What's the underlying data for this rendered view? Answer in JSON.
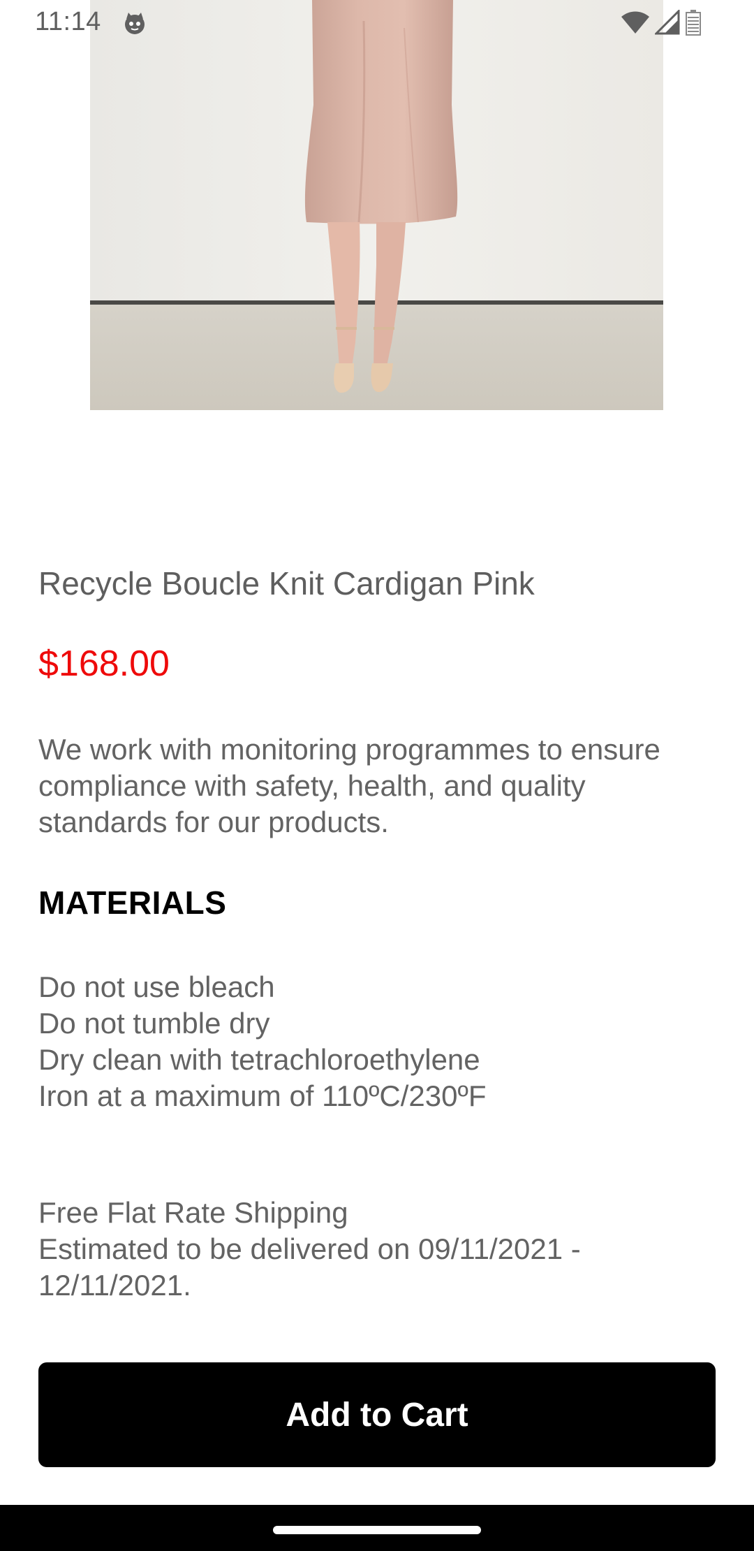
{
  "status_bar": {
    "time": "11:14",
    "app_icon": "cat-face-icon",
    "wifi_icon": "wifi-icon",
    "signal_icon": "cell-signal-icon",
    "battery_icon": "battery-icon"
  },
  "product": {
    "image": "product-photo-pink-skirt",
    "title": "Recycle Boucle Knit Cardigan Pink",
    "price": "$168.00",
    "description": "We work with monitoring programmes to ensure compliance with safety, health, and quality standards for our products."
  },
  "materials": {
    "heading": "MATERIALS",
    "care_instructions": [
      "Do not use bleach",
      "Do not tumble dry",
      "Dry clean with tetrachloroethylene",
      "Iron at a maximum of 110ºC/230ºF"
    ]
  },
  "shipping": {
    "line1": "Free Flat Rate Shipping",
    "line2": "Estimated to be delivered on 09/11/2021 - 12/11/2021."
  },
  "actions": {
    "add_to_cart_label": "Add to Cart"
  },
  "colors": {
    "price": "#ee0a0a",
    "button": "#000000",
    "body_text": "#636363"
  }
}
